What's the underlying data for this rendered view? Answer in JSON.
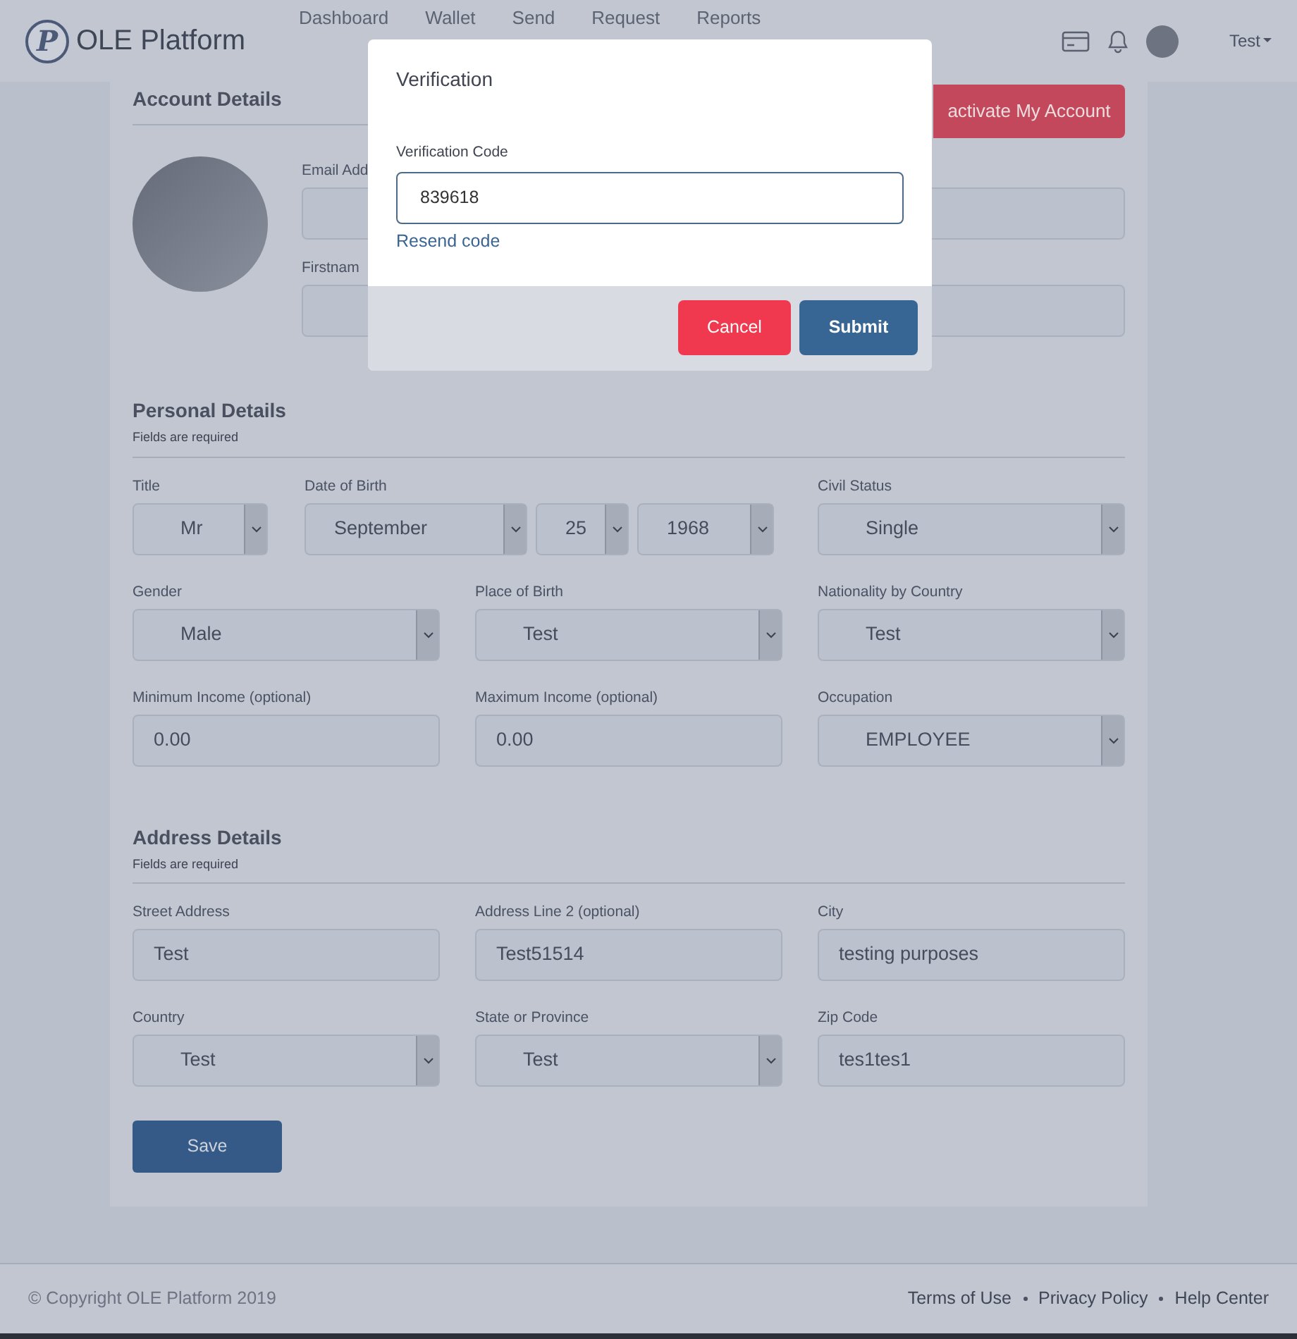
{
  "navbar": {
    "logo_letter": "P",
    "brand": "OLE Platform",
    "links": [
      "Dashboard",
      "Wallet",
      "Send",
      "Request",
      "Reports"
    ],
    "user": "Test"
  },
  "account_details": {
    "title": "Account Details",
    "action_button": "activate My Account",
    "fields": [
      {
        "label": "Email Add"
      },
      {
        "label": "Firstnam"
      }
    ]
  },
  "personal_details": {
    "title": "Personal Details",
    "subtitle": "Fields are required",
    "fields": [
      {
        "kind": "select",
        "label": "Title",
        "value": "Mr"
      },
      {
        "kind": "date",
        "label": "Date of Birth",
        "parts": [
          "September",
          "25",
          "1968"
        ]
      },
      {
        "kind": "select",
        "label": "Civil Status",
        "value": "Single"
      },
      {
        "kind": "select",
        "label": "Gender",
        "value": "Male"
      },
      {
        "kind": "select",
        "label": "Place of Birth",
        "value": "Test"
      },
      {
        "kind": "select",
        "label": "Nationality by Country",
        "value": "Test"
      },
      {
        "kind": "input",
        "label": "Minimum Income (optional)",
        "value": "0.00"
      },
      {
        "kind": "input",
        "label": "Maximum Income (optional)",
        "value": "0.00"
      },
      {
        "kind": "select",
        "label": "Occupation",
        "value": "EMPLOYEE"
      }
    ]
  },
  "address_details": {
    "title": "Address Details",
    "subtitle": "Fields are required",
    "fields": [
      {
        "kind": "input",
        "label": "Street Address",
        "value": "Test"
      },
      {
        "kind": "input",
        "label": "Address Line 2 (optional)",
        "value": "Test51514"
      },
      {
        "kind": "input",
        "label": "City",
        "value": "testing purposes"
      },
      {
        "kind": "select",
        "label": "Country",
        "value": "Test"
      },
      {
        "kind": "select",
        "label": "State or Province",
        "value": "Test"
      },
      {
        "kind": "input",
        "label": "Zip Code",
        "value": "tes1tes1"
      }
    ]
  },
  "save_button": "Save",
  "modal": {
    "title": "Verification",
    "field_label": "Verification Code",
    "value": "839618",
    "resend_link": "Resend code",
    "buttons": [
      {
        "kind": "cancel",
        "label": "Cancel"
      },
      {
        "kind": "submit",
        "label": "Submit"
      }
    ]
  },
  "footer": {
    "copyright": "© Copyright OLE Platform 2019",
    "links": [
      "Terms of Use",
      "Privacy Policy",
      "Help Center"
    ]
  }
}
